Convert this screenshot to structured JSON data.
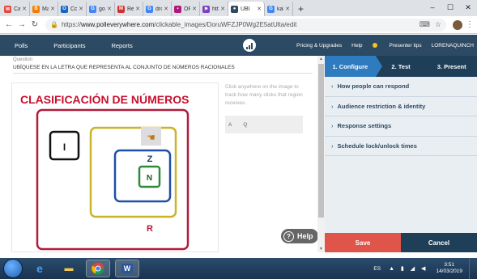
{
  "browser": {
    "tabs": [
      {
        "title": "Cal",
        "color": "#e8453c",
        "glyph": "✉"
      },
      {
        "title": "Ma",
        "color": "#f57c00",
        "glyph": "B"
      },
      {
        "title": "Co",
        "color": "#1565c0",
        "glyph": "O"
      },
      {
        "title": "goo",
        "color": "#4285f4",
        "glyph": "G"
      },
      {
        "title": "Re",
        "color": "#d32f2f",
        "glyph": "M"
      },
      {
        "title": "dro",
        "color": "#4285f4",
        "glyph": "G"
      },
      {
        "title": "OR",
        "color": "#b0187a",
        "glyph": "▪"
      },
      {
        "title": "htt",
        "color": "#7b3fbf",
        "glyph": "⚑"
      },
      {
        "title": "UBI",
        "color": "#2c4a63",
        "glyph": "●",
        "active": true
      },
      {
        "title": "kah",
        "color": "#4285f4",
        "glyph": "G"
      }
    ],
    "new_tab": "+",
    "url_prefix": "https://",
    "url_domain": "www.polleverywhere.com",
    "url_path": "/clickable_images/DoruWFZJP0Wg2E5atUlta/edit"
  },
  "header": {
    "nav": [
      "Polls",
      "Participants",
      "Reports"
    ],
    "right": {
      "pricing": "Pricing & Upgrades",
      "help": "Help",
      "tips": "Presenter tips",
      "user": "LORENAQUINCH"
    }
  },
  "question": {
    "label": "Question",
    "text": "UBÍQUESE EN  LA LETRA QUE REPRESENTA AL CONJUNTO DE NÚMEROS RACIONALES"
  },
  "image": {
    "title": "CLASIFICACIÓN DE NÚMEROS",
    "sets": {
      "I": "I",
      "Z": "Z",
      "N": "N",
      "R": "R"
    },
    "marker_glyph": "☚"
  },
  "hint": "Click anywhere on the image to track how many clicks that region receives.",
  "answers": [
    "A",
    "Q"
  ],
  "help_label": "Help",
  "steps": [
    "1. Configure",
    "2. Test",
    "3. Present"
  ],
  "accordion": [
    "How people can respond",
    "Audience restriction & identity",
    "Response settings",
    "Schedule lock/unlock times"
  ],
  "buttons": {
    "save": "Save",
    "cancel": "Cancel"
  },
  "taskbar": {
    "lang": "ES",
    "time": "3:51",
    "date": "14/03/2019"
  },
  "colors": {
    "header": "#2c4a63",
    "accent": "#2f7bbf",
    "save": "#e0554a",
    "title_red": "#c8102e",
    "set_R": "#b01c3c",
    "set_Q": "#c9b42a",
    "set_Z": "#1f4fa8",
    "set_N": "#2e8b3e"
  }
}
